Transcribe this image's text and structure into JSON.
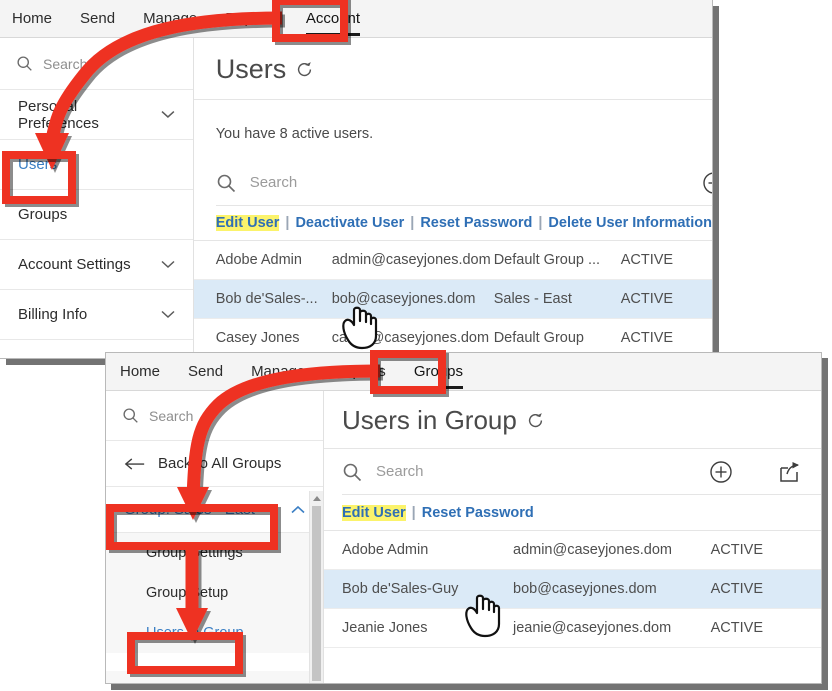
{
  "meta": {
    "accent_red": "#ee3124",
    "highlight_yellow": "#fbf36b",
    "link_blue": "#2f6fb5",
    "row_selected_blue": "#dbeaf7"
  },
  "window_top": {
    "nav": {
      "items": [
        {
          "label": "Home",
          "active": false
        },
        {
          "label": "Send",
          "active": false
        },
        {
          "label": "Manage",
          "active": false
        },
        {
          "label": "Reports",
          "active": false
        },
        {
          "label": "Account",
          "active": true
        }
      ]
    },
    "sidebar": {
      "search_placeholder": "Search",
      "items": [
        {
          "label": "Personal Preferences",
          "chevron": "chevron-down",
          "link": false
        },
        {
          "label": "Users",
          "chevron": "",
          "link": true
        },
        {
          "label": "Groups",
          "chevron": "",
          "link": false
        },
        {
          "label": "Account Settings",
          "chevron": "chevron-down",
          "link": false
        },
        {
          "label": "Billing Info",
          "chevron": "chevron-down",
          "link": false
        }
      ]
    },
    "content": {
      "title": "Users",
      "refresh_icon": "refresh-icon",
      "info": "You have 8 active users.",
      "search_placeholder": "Search",
      "add_icon": "plus-circle-icon",
      "actions": [
        {
          "label": "Edit User",
          "highlighted": true
        },
        {
          "label": "Deactivate User",
          "highlighted": false
        },
        {
          "label": "Reset Password",
          "highlighted": false
        },
        {
          "label": "Delete User Information",
          "highlighted": false
        }
      ],
      "action_separator": "|",
      "rows": [
        {
          "name": "Adobe Admin",
          "email": "admin@caseyjones.dom",
          "group": "Default Group ...",
          "status": "ACTIVE",
          "selected": false
        },
        {
          "name": "Bob de'Sales-...",
          "email": "bob@caseyjones.dom",
          "group": "Sales - East",
          "status": "ACTIVE",
          "selected": true
        },
        {
          "name": "Casey Jones",
          "email": "casey@caseyjones.dom",
          "group": "Default Group",
          "status": "ACTIVE",
          "selected": false
        }
      ]
    }
  },
  "window_bottom": {
    "nav": {
      "items": [
        {
          "label": "Home",
          "active": false
        },
        {
          "label": "Send",
          "active": false
        },
        {
          "label": "Manage",
          "active": false
        },
        {
          "label": "Reports",
          "active": false
        },
        {
          "label": "Groups",
          "active": true
        }
      ]
    },
    "sidebar": {
      "search_placeholder": "Search",
      "back_label": "Back to All Groups",
      "back_icon": "arrow-left-icon",
      "group_label": "Group: Sales - East",
      "group_chevron": "chevron-up",
      "sub_items": [
        {
          "label": "Group Settings",
          "link": false
        },
        {
          "label": "Group Setup",
          "link": false
        },
        {
          "label": "Users in Group",
          "link": true
        }
      ]
    },
    "content": {
      "title": "Users in Group",
      "refresh_icon": "refresh-icon",
      "search_placeholder": "Search",
      "add_icon": "plus-circle-icon",
      "export_icon": "export-icon",
      "actions": [
        {
          "label": "Edit User",
          "highlighted": true
        },
        {
          "label": "Reset Password",
          "highlighted": false
        }
      ],
      "action_separator": "|",
      "rows": [
        {
          "name": "Adobe Admin",
          "email": "admin@caseyjones.dom",
          "status": "ACTIVE",
          "selected": false
        },
        {
          "name": "Bob de'Sales-Guy",
          "email": "bob@caseyjones.dom",
          "status": "ACTIVE",
          "selected": true
        },
        {
          "name": "Jeanie Jones",
          "email": "jeanie@caseyjones.dom",
          "status": "ACTIVE",
          "selected": false
        }
      ]
    }
  },
  "annotations": {
    "boxes": [
      {
        "name": "account-tab-callout"
      },
      {
        "name": "users-sidebar-callout"
      },
      {
        "name": "groups-tab-callout"
      },
      {
        "name": "group-sales-east-callout"
      },
      {
        "name": "users-in-group-callout"
      }
    ],
    "arrows": [
      {
        "name": "account-to-users-arrow"
      },
      {
        "name": "groups-to-group-arrow"
      },
      {
        "name": "group-to-users-in-group-arrow"
      }
    ],
    "cursors": [
      {
        "name": "hand-cursor-top"
      },
      {
        "name": "hand-cursor-bottom"
      }
    ]
  }
}
